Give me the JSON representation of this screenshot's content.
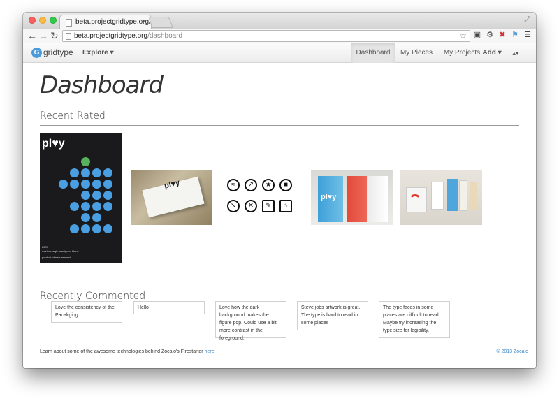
{
  "browser": {
    "tab_title": "beta.projectgridtype.org/d",
    "url_host": "beta.projectgridtype.org",
    "url_path": "/dashboard"
  },
  "navbar": {
    "brand_letter": "G",
    "brand_name": "gridtype",
    "explore_label": "Explore ▾",
    "items": [
      {
        "label": "Dashboard",
        "active": true
      },
      {
        "label": "My Pieces"
      },
      {
        "label": "My Projects"
      },
      {
        "label": "Add ▾"
      },
      {
        "label": "▴▾"
      }
    ]
  },
  "page": {
    "title": "Dashboard",
    "recent_rated_heading": "Recent Rated",
    "recently_commented_heading": "Recently Commented"
  },
  "recent_rated": {
    "poster": {
      "title": "pl♥y",
      "year": "2009",
      "wine": "marlborough sauvignon blanc",
      "origin": "product of new zealand"
    },
    "carton_word": "pl♥y",
    "milk_word": "pl♥y"
  },
  "comments": [
    "Love the consistency of the Pacakging",
    "Hello",
    "Love how the dark background makes the figure pop. Could use a bit more contrast in the foreground.",
    "Steve jobs artwork is great. The type is hard to read in some places",
    "The type faces in some places are difficult to read. Maybe try increasing the type size for legibility."
  ],
  "footer": {
    "text": "Learn about some of the awesome technologies behind Zocalo's Firestarter",
    "link": "here.",
    "copyright": "© 2013 Zocalo"
  },
  "colors": {
    "accent_blue": "#4a9fe3",
    "accent_green": "#56b25c",
    "link": "#3a87c9"
  }
}
